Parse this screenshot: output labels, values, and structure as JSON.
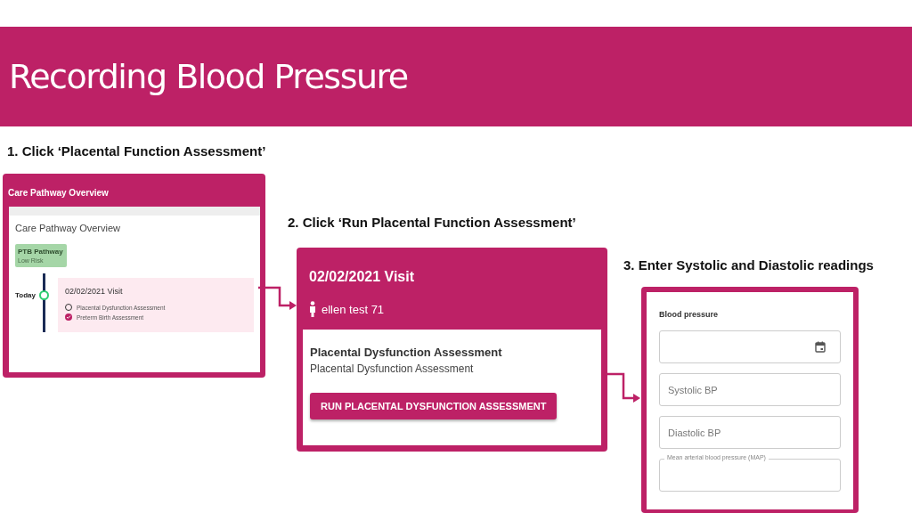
{
  "title": "Recording Blood Pressure",
  "steps": [
    {
      "label": "1. Click ‘Placental Function Assessment’"
    },
    {
      "label": "2. Click ‘Run Placental Function Assessment’"
    },
    {
      "label": "3. Enter Systolic and Diastolic readings"
    }
  ],
  "overview_panel": {
    "header": "Care Pathway Overview",
    "heading": "Care Pathway Overview",
    "pathway": {
      "name": "PTB Pathway",
      "risk": "Low Risk"
    },
    "timeline_label": "Today",
    "visit": {
      "title": "02/02/2021 Visit",
      "assessments": [
        {
          "name": "Placental Dysfunction Assessment",
          "checked": false
        },
        {
          "name": "Preterm Birth Assessment",
          "checked": true
        }
      ]
    }
  },
  "visit_panel": {
    "title": "02/02/2021 Visit",
    "patient": "ellen test 71",
    "assessment_title": "Placental Dysfunction Assessment",
    "assessment_subtitle": "Placental Dysfunction Assessment",
    "button": "RUN PLACENTAL DYSFUNCTION ASSESSMENT"
  },
  "bp_panel": {
    "heading": "Blood pressure",
    "fields": [
      {
        "kind": "date"
      },
      {
        "kind": "text",
        "placeholder": "Systolic BP"
      },
      {
        "kind": "text",
        "placeholder": "Diastolic BP"
      },
      {
        "kind": "outlined",
        "label": "Mean arterial blood pressure (MAP)"
      }
    ]
  }
}
